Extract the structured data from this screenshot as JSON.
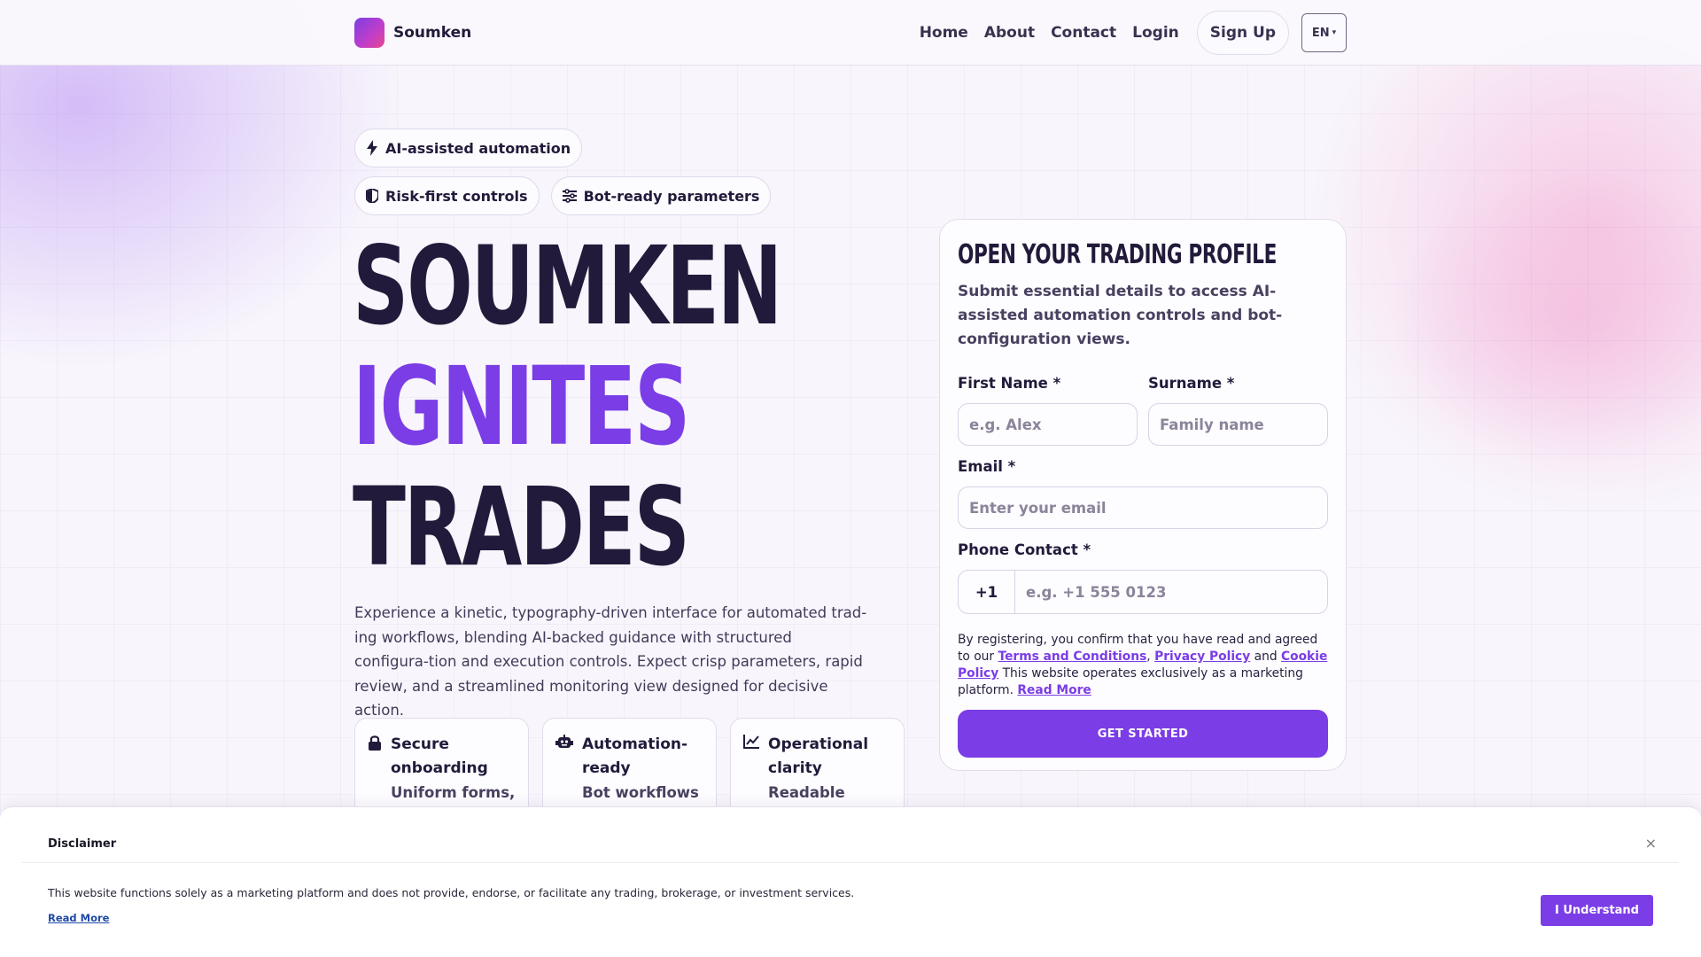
{
  "header": {
    "brand": "Soumken",
    "nav": [
      "Home",
      "About",
      "Contact",
      "Login"
    ],
    "signup": "Sign Up",
    "lang": "EN"
  },
  "hero": {
    "chips": [
      "AI-assisted automation",
      "Risk-first controls",
      "Bot-ready parameters"
    ],
    "headline": [
      "SOUMKEN",
      "IGNITES",
      "TRADES"
    ],
    "description": "Experience a kinetic, typography-driven interface for automated trad-ing workflows, blending AI-backed guidance with structured configura-tion and execution controls. Expect crisp parameters, rapid review, and a streamlined monitoring view designed for decisive action.",
    "features": [
      {
        "title": "Secure onboarding",
        "sub": "Uniform forms,",
        "icon": "lock-icon"
      },
      {
        "title": "Automation-ready",
        "sub": "Bot workflows",
        "icon": "robot-icon"
      },
      {
        "title": "Operational clarity",
        "sub": "Readable states",
        "icon": "chart-icon"
      }
    ]
  },
  "form": {
    "title": "OPEN YOUR TRADING PROFILE",
    "subtitle": "Submit essential details to access AI-assisted automation controls and bot-configuration views.",
    "first_name_label": "First Name *",
    "first_name_placeholder": "e.g. Alex",
    "surname_label": "Surname *",
    "surname_placeholder": "Family name",
    "email_label": "Email *",
    "email_placeholder": "Enter your email",
    "phone_label": "Phone Contact *",
    "phone_code": "+1",
    "phone_placeholder": "e.g. +1 555 0123",
    "legal_pre": "By registering, you confirm that you have read and agreed to our ",
    "terms": "Terms and Conditions",
    "comma": ", ",
    "privacy": "Privacy Policy",
    "and": " and ",
    "cookie": "Cookie Policy",
    "legal_post": " This website operates exclusively as a marketing platform. ",
    "read_more": "Read More",
    "cta": "GET STARTED"
  },
  "disclaimer": {
    "title": "Disclaimer",
    "close": "×",
    "text": "This website functions solely as a marketing platform and does not provide, endorse, or facilitate any trading, brokerage, or investment services.",
    "read_more": "Read More",
    "button": "I Understand"
  },
  "colors": {
    "accent": "#7b3de6",
    "ink": "#221a3a"
  }
}
